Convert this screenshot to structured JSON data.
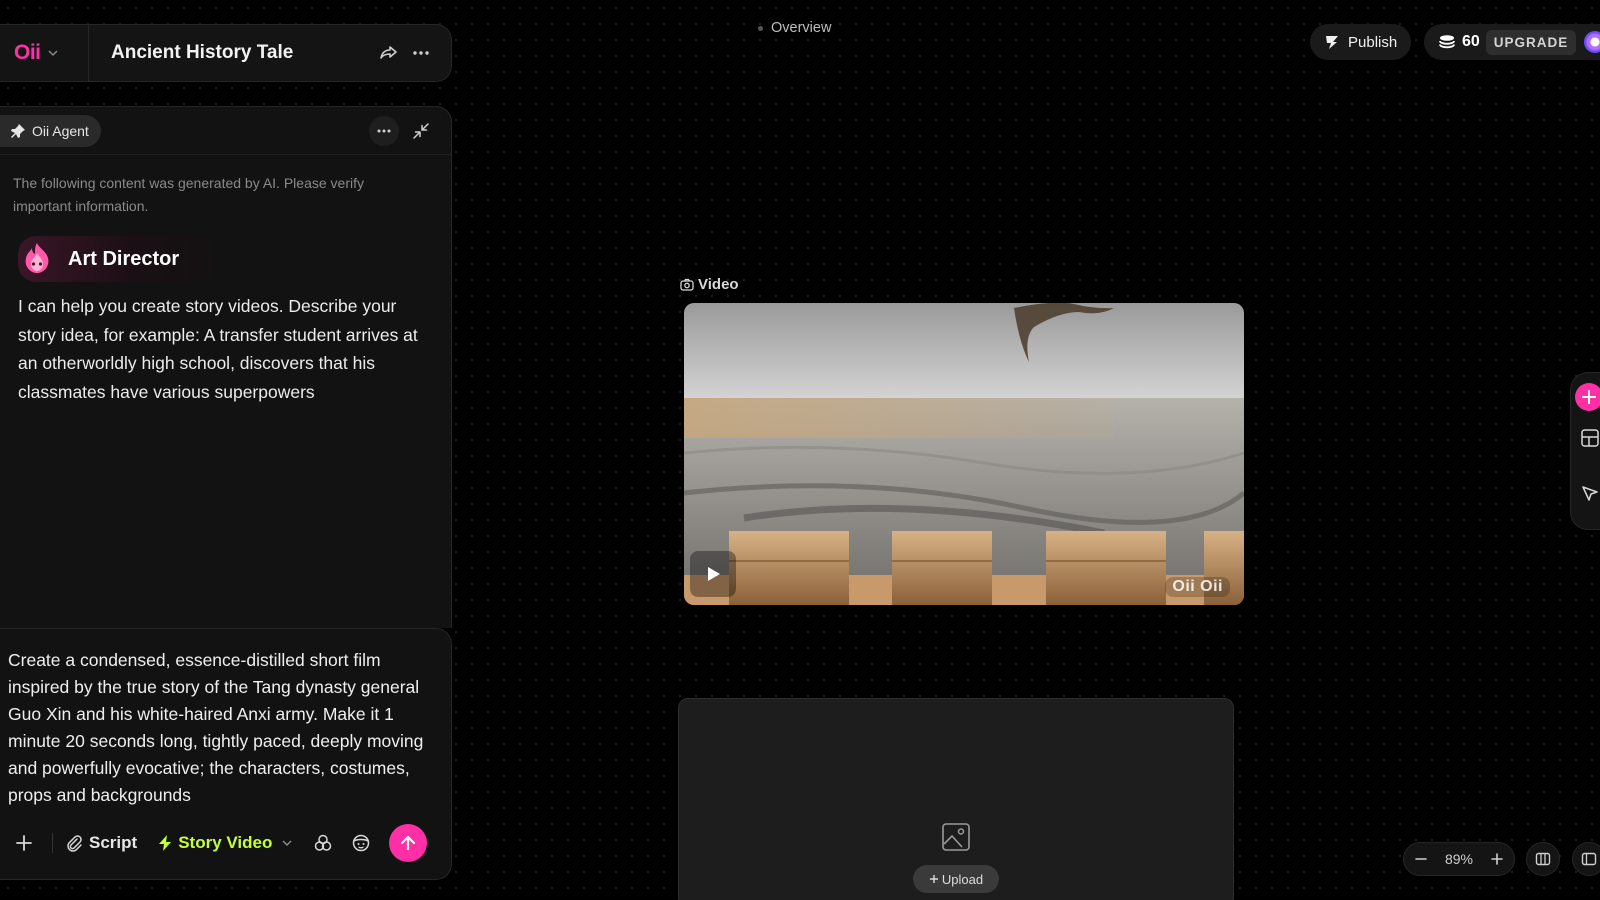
{
  "app": {
    "logo_text": "Oii",
    "project_title": "Ancient History Tale"
  },
  "agent": {
    "name": "Oii Agent",
    "disclaimer": "The following content was generated by AI. Please verify important information.",
    "persona_name": "Art Director",
    "message": "I can help you create story videos. Describe your story idea, for example: A transfer student arrives at an otherworldly high school, discovers that his classmates have various superpowers"
  },
  "composer": {
    "draft": "Create a condensed, essence-distilled short film inspired by the true story of the Tang dynasty general Guo Xin and his white-haired Anxi army. Make it 1 minute 20 seconds long, tightly paced, deeply moving and powerfully evocative; the characters, costumes, props and backgrounds",
    "script_label": "Script",
    "mode_label": "Story Video"
  },
  "canvas": {
    "overview_label": "Overview",
    "video_label": "Video",
    "video_watermark": "Oii Oii",
    "upload_label": "Upload"
  },
  "header_right": {
    "publish_label": "Publish",
    "credits": "60",
    "upgrade_label": "UPGRADE"
  },
  "zoom": {
    "value": "89%"
  },
  "colors": {
    "accent_pink": "#ff2fa6",
    "accent_lime": "#c6ff3a",
    "background": "#000000"
  }
}
